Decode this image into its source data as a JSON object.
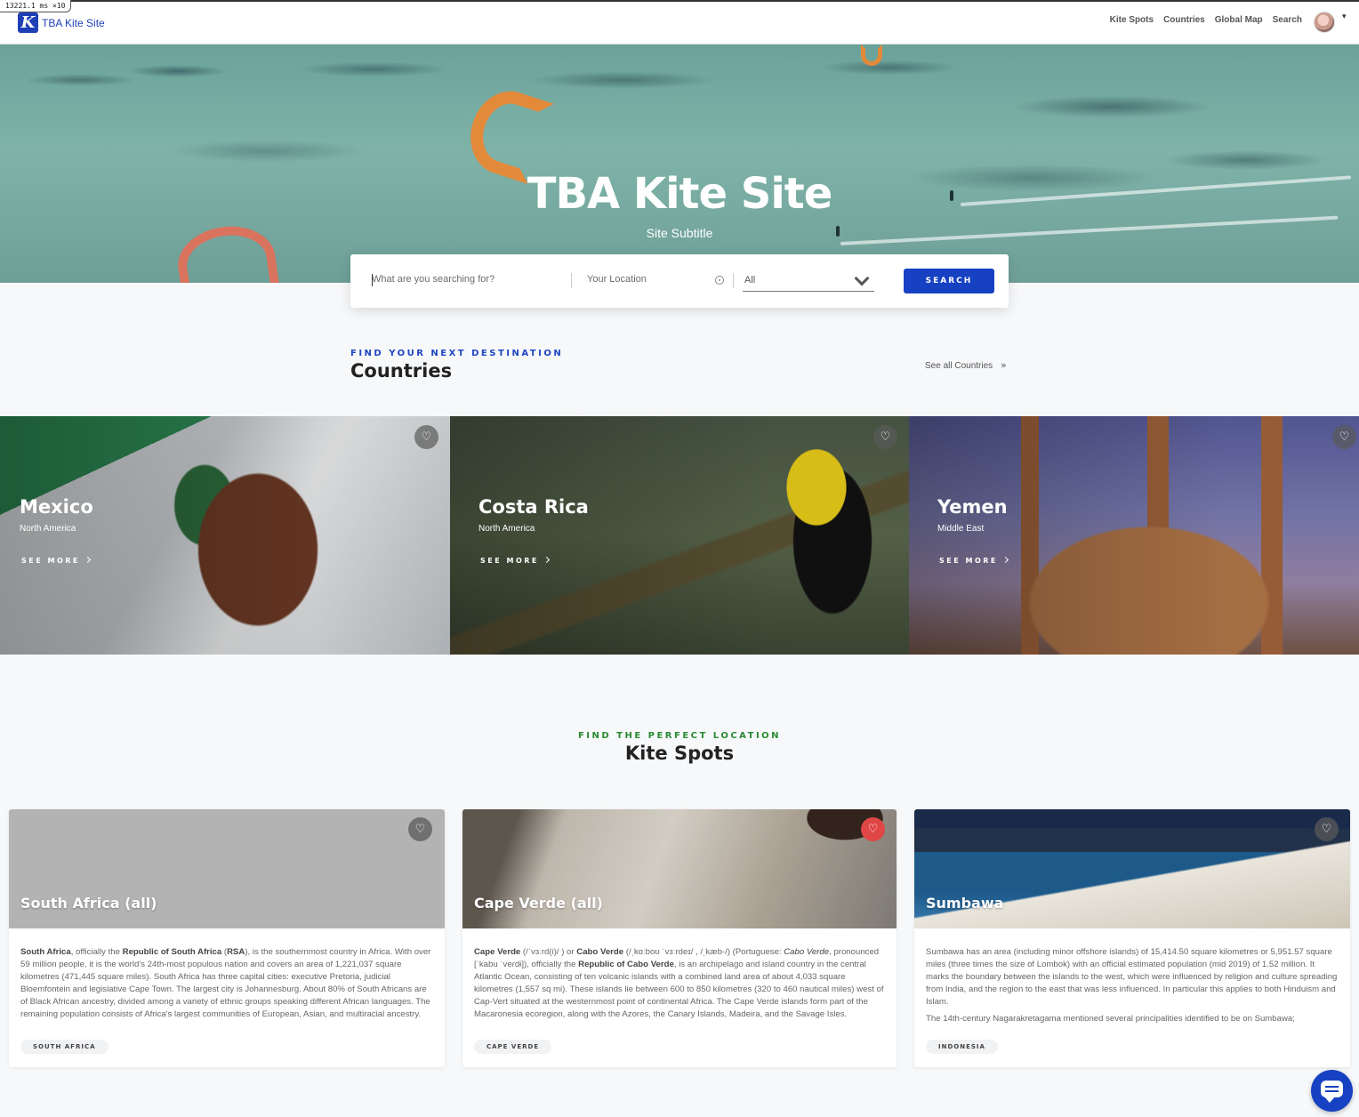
{
  "debug": {
    "label": "13221.1 ms ×10"
  },
  "nav": {
    "logo_mark": "K",
    "logo_text": "TBA Kite Site",
    "links": [
      "Kite Spots",
      "Countries",
      "Global Map",
      "Search"
    ],
    "avatar_caret": "▾"
  },
  "hero": {
    "title": "TBA Kite Site",
    "subtitle": "Site Subtitle"
  },
  "search": {
    "query_placeholder": "What are you searching for?",
    "location_placeholder": "Your Location",
    "category_value": "All",
    "button_label": "SEARCH"
  },
  "countries_section": {
    "eyebrow": "FIND YOUR NEXT DESTINATION",
    "title": "Countries",
    "see_all": "See all Countries",
    "see_all_icon": "»",
    "see_more": "SEE MORE",
    "cards": [
      {
        "name": "Mexico",
        "region": "North America",
        "image": "mexico-flag-image"
      },
      {
        "name": "Costa Rica",
        "region": "North America",
        "image": "toucan-image"
      },
      {
        "name": "Yemen",
        "region": "Middle East",
        "image": "mosque-image"
      }
    ]
  },
  "spots_section": {
    "eyebrow": "FIND THE PERFECT LOCATION",
    "title": "Kite Spots",
    "cards": [
      {
        "name": "South Africa (all)",
        "tag": "SOUTH AFRICA",
        "favorited": false
      },
      {
        "name": "Cape Verde (all)",
        "tag": "CAPE VERDE",
        "favorited": true
      },
      {
        "name": "Sumbawa",
        "tag": "INDONESIA",
        "favorited": false
      }
    ],
    "descriptions": {
      "sa": {
        "t1": "South Africa",
        "t2": ", officially the ",
        "t3": "Republic of South Africa",
        "t4": " (",
        "t5": "RSA",
        "t6": "), is the southernmost country in Africa. With over 59 million people, it is the world's 24th-most populous nation and covers an area of 1,221,037 square kilometres (471,445 square miles). South Africa has three capital cities: executive Pretoria, judicial Bloemfontein and legislative Cape Town. The largest city is Johannesburg. About 80% of South Africans are of Black African ancestry, divided among a variety of ethnic groups speaking different African languages. The remaining population consists of Africa's largest communities of European, Asian, and multiracial ancestry."
      },
      "cv": {
        "t1": "Cape Verde",
        "t2": " (/ˈvɜːrd(i)/ ) or ",
        "t3": "Cabo Verde",
        "t4": " (/ˌkɑːboʊ ˈvɜːrdeɪ/ , /ˌkæb-/) (Portuguese: ",
        "t5": "Cabo Verde",
        "t6": ", pronounced [ˈkabu ˈveɾdɨ]), officially the ",
        "t7": "Republic of Cabo Verde",
        "t8": ", is an archipelago and island country in the central Atlantic Ocean, consisting of ten volcanic islands with a combined land area of about 4,033 square kilometres (1,557 sq mi). These islands lie between 600 to 850 kilometres (320 to 460 nautical miles) west of Cap-Vert situated at the westernmost point of continental Africa. The Cape Verde islands form part of the Macaronesia ecoregion, along with the Azores, the Canary Islands, Madeira, and the Savage Isles."
      },
      "sb": {
        "p1": "Sumbawa has an area (including minor offshore islands) of 15,414.50 square kilometres or 5,951.57 square miles (three times the size of Lombok) with an official estimated population (mid 2019) of 1.52 million. It marks the boundary between the islands to the west, which were influenced by religion and culture spreading from India, and the region to the east that was less influenced. In particular this applies to both Hinduism and Islam.",
        "p2": "The 14th-century Nagarakretagama mentioned several principalities identified to be on Sumbawa;"
      }
    }
  },
  "chat": {
    "icon": "chat-bubble-icon"
  }
}
